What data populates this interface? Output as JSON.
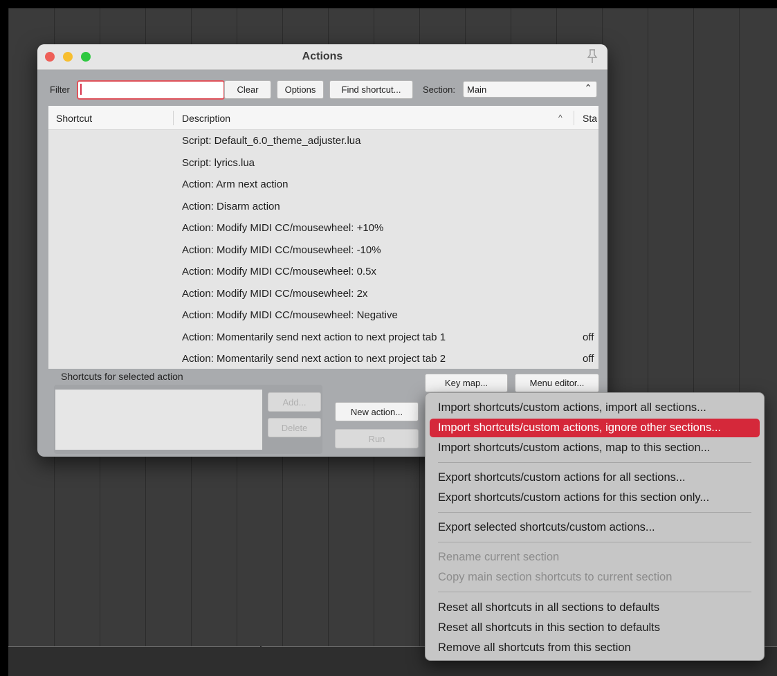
{
  "window": {
    "title": "Actions"
  },
  "toolbar": {
    "filter_label": "Filter",
    "filter_value": "",
    "clear": "Clear",
    "options": "Options",
    "find_shortcut": "Find shortcut...",
    "section_label": "Section:",
    "section_value": "Main"
  },
  "table": {
    "headers": {
      "shortcut": "Shortcut",
      "description": "Description",
      "state": "Sta"
    },
    "rows": [
      {
        "shortcut": "",
        "description": "Script: Default_6.0_theme_adjuster.lua",
        "state": ""
      },
      {
        "shortcut": "",
        "description": "Script: lyrics.lua",
        "state": ""
      },
      {
        "shortcut": "",
        "description": "Action: Arm next action",
        "state": ""
      },
      {
        "shortcut": "",
        "description": "Action: Disarm action",
        "state": ""
      },
      {
        "shortcut": "",
        "description": "Action: Modify MIDI CC/mousewheel: +10%",
        "state": ""
      },
      {
        "shortcut": "",
        "description": "Action: Modify MIDI CC/mousewheel: -10%",
        "state": ""
      },
      {
        "shortcut": "",
        "description": "Action: Modify MIDI CC/mousewheel: 0.5x",
        "state": ""
      },
      {
        "shortcut": "",
        "description": "Action: Modify MIDI CC/mousewheel: 2x",
        "state": ""
      },
      {
        "shortcut": "",
        "description": "Action: Modify MIDI CC/mousewheel: Negative",
        "state": ""
      },
      {
        "shortcut": "",
        "description": "Action: Momentarily send next action to next project tab 1",
        "state": "off"
      },
      {
        "shortcut": "",
        "description": "Action: Momentarily send next action to next project tab 2",
        "state": "off"
      }
    ]
  },
  "bottom": {
    "selected_label": "Shortcuts for selected action",
    "add": "Add...",
    "delete": "Delete",
    "new_action": "New action...",
    "run": "Run",
    "key_map": "Key map...",
    "menu_editor": "Menu editor..."
  },
  "menu": {
    "items": [
      {
        "label": "Import shortcuts/custom actions, import all sections...",
        "state": "normal"
      },
      {
        "label": "Import shortcuts/custom actions, ignore other sections...",
        "state": "highlighted"
      },
      {
        "label": "Import shortcuts/custom actions, map to this section...",
        "state": "normal"
      },
      {
        "label": "Export shortcuts/custom actions for all sections...",
        "state": "normal"
      },
      {
        "label": "Export shortcuts/custom actions for this section only...",
        "state": "normal"
      },
      {
        "label": "Export selected shortcuts/custom actions...",
        "state": "normal"
      },
      {
        "label": "Rename current section",
        "state": "disabled"
      },
      {
        "label": "Copy main section shortcuts to current section",
        "state": "disabled"
      },
      {
        "label": "Reset all shortcuts in all sections to defaults",
        "state": "normal"
      },
      {
        "label": "Reset all shortcuts in this section to defaults",
        "state": "normal"
      },
      {
        "label": "Remove all shortcuts from this section",
        "state": "normal"
      }
    ]
  },
  "colors": {
    "highlight": "#d5283a",
    "close": "#ee5f58",
    "minimize": "#f7be2f",
    "maximize": "#2ec840"
  }
}
